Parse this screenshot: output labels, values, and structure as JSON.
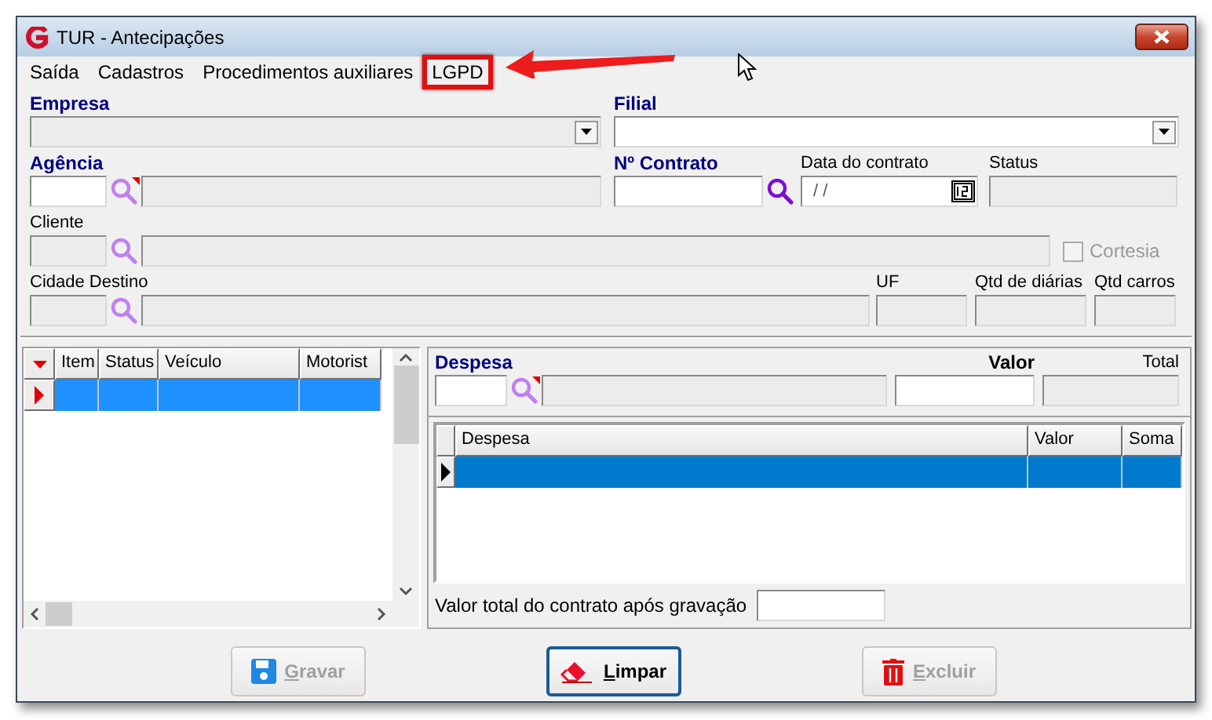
{
  "window": {
    "title": "TUR - Antecipações"
  },
  "menu": [
    {
      "label": "Saída",
      "highlighted": false
    },
    {
      "label": "Cadastros",
      "highlighted": false
    },
    {
      "label": "Procedimentos auxiliares",
      "highlighted": false
    },
    {
      "label": "LGPD",
      "highlighted": true
    }
  ],
  "form_rows": [
    [
      {
        "kind": "combo",
        "label": "Empresa",
        "required": true,
        "disabled": true
      },
      {
        "kind": "combo",
        "label": "Filial",
        "required": true,
        "disabled": false
      }
    ],
    [
      {
        "kind": "lookup",
        "label": "Agência",
        "required": true,
        "code_disabled": false,
        "name_disabled": true,
        "flagged": true
      },
      {
        "kind": "search",
        "label": "Nº Contrato",
        "required": true,
        "disabled": false
      },
      {
        "kind": "date",
        "label": "Data do contrato",
        "required": false,
        "value": "/ /",
        "disabled": false
      },
      {
        "kind": "text",
        "label": "Status",
        "required": false,
        "disabled": true
      }
    ],
    [
      {
        "kind": "lookup",
        "label": "Cliente",
        "required": false,
        "code_disabled": true,
        "name_disabled": true,
        "flagged": false
      },
      {
        "kind": "checkbox",
        "label": "Cortesia",
        "checked": false,
        "disabled": true
      }
    ],
    [
      {
        "kind": "lookup",
        "label": "Cidade Destino",
        "required": false,
        "code_disabled": true,
        "name_disabled": true,
        "flagged": false
      },
      {
        "kind": "text",
        "label": "UF",
        "required": false,
        "disabled": true
      },
      {
        "kind": "text",
        "label": "Qtd de diárias",
        "required": false,
        "disabled": true
      },
      {
        "kind": "text",
        "label": "Qtd carros",
        "required": false,
        "disabled": true
      }
    ]
  ],
  "vehicle_grid": {
    "columns": [
      "Item",
      "Status",
      "Veículo",
      "Motorist"
    ],
    "rows": [
      {
        "selected": true
      }
    ]
  },
  "expense_form": [
    {
      "kind": "lookup",
      "label": "Despesa",
      "required": true,
      "bold": false,
      "code_disabled": false,
      "name_disabled": true,
      "flagged": true
    },
    {
      "kind": "text",
      "label": "Valor",
      "required": false,
      "bold": true,
      "disabled": false
    },
    {
      "kind": "text",
      "label": "Total",
      "required": false,
      "bold": false,
      "disabled": true
    }
  ],
  "expense_grid": {
    "columns": [
      "Despesa",
      "Valor",
      "Soma"
    ],
    "rows": [
      {
        "selected": true
      }
    ]
  },
  "total_after_save": {
    "label": "Valor total do contrato após gravação"
  },
  "buttons": [
    {
      "label": "Gravar",
      "disabled": true,
      "focused": false
    },
    {
      "label": "Limpar",
      "disabled": false,
      "focused": true
    },
    {
      "label": "Excluir",
      "disabled": true,
      "focused": false
    }
  ]
}
